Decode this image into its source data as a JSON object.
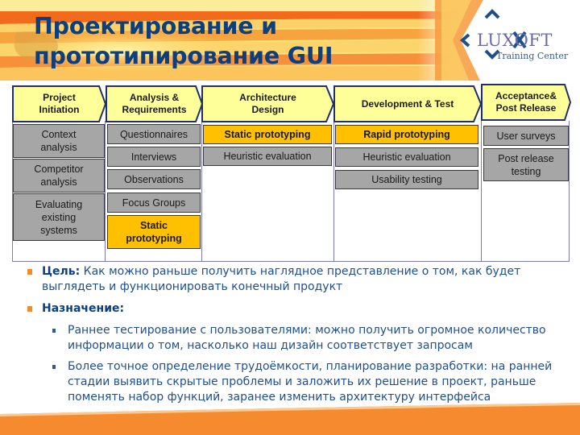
{
  "title": {
    "line1": "Проектирование и",
    "line2": "прототипирование GUI"
  },
  "logo": {
    "word": "LUXOFT",
    "subtitle": "Training Center",
    "icon": "luxoft-arrows-icon"
  },
  "colors": {
    "title": "#0d3f7e",
    "phase_fill": "#ffff99",
    "phase_border": "#1f2f6f",
    "activity_gray": "#a6a6a6",
    "activity_highlight": "#fec000",
    "column_border": "#7d7ab8",
    "bullet_orange": "#f28b30",
    "banner_orange": "#f58a2f"
  },
  "phases": [
    {
      "label": "Project\nInitiation",
      "activities": [
        {
          "label": "Context\nanalysis",
          "highlight": false
        },
        {
          "label": "Competitor\nanalysis",
          "highlight": false
        },
        {
          "label": "Evaluating\nexisting\nsystems",
          "highlight": false
        }
      ]
    },
    {
      "label": "Analysis &\nRequirements",
      "activities": [
        {
          "label": "Questionnaires",
          "highlight": false
        },
        {
          "label": "Interviews",
          "highlight": false
        },
        {
          "label": "Observations",
          "highlight": false
        },
        {
          "label": "Focus Groups",
          "highlight": false
        },
        {
          "label": "Static\nprototyping",
          "highlight": true
        }
      ]
    },
    {
      "label": "Architecture\nDesign",
      "activities": [
        {
          "label": "Static prototyping",
          "highlight": true
        },
        {
          "label": "Heuristic evaluation",
          "highlight": false
        }
      ]
    },
    {
      "label": "Development & Test",
      "activities": [
        {
          "label": "Rapid prototyping",
          "highlight": true
        },
        {
          "label": "Heuristic evaluation",
          "highlight": false
        },
        {
          "label": "Usability testing",
          "highlight": false
        }
      ]
    },
    {
      "label": "Acceptance&\nPost Release",
      "activities": [
        {
          "label": "User surveys",
          "highlight": false
        },
        {
          "label": "Post release\ntesting",
          "highlight": false
        }
      ]
    }
  ],
  "bullets": [
    {
      "label": "Цель:",
      "text": "Как можно раньше получить наглядное представление о том, как будет выглядеть и функционировать конечный продукт"
    },
    {
      "label": "Назначение:",
      "text": "",
      "subitems": [
        "Раннее тестирование с пользователями: можно получить огромное количество информации о том, насколько наш дизайн соответствует запросам",
        "Более точное определение трудоёмкости, планирование  разработки: на ранней стадии выявить скрытые проблемы и заложить их решение в проект, раньше поменять набор функций, заранее изменить архитектуру интерфейса"
      ]
    }
  ]
}
